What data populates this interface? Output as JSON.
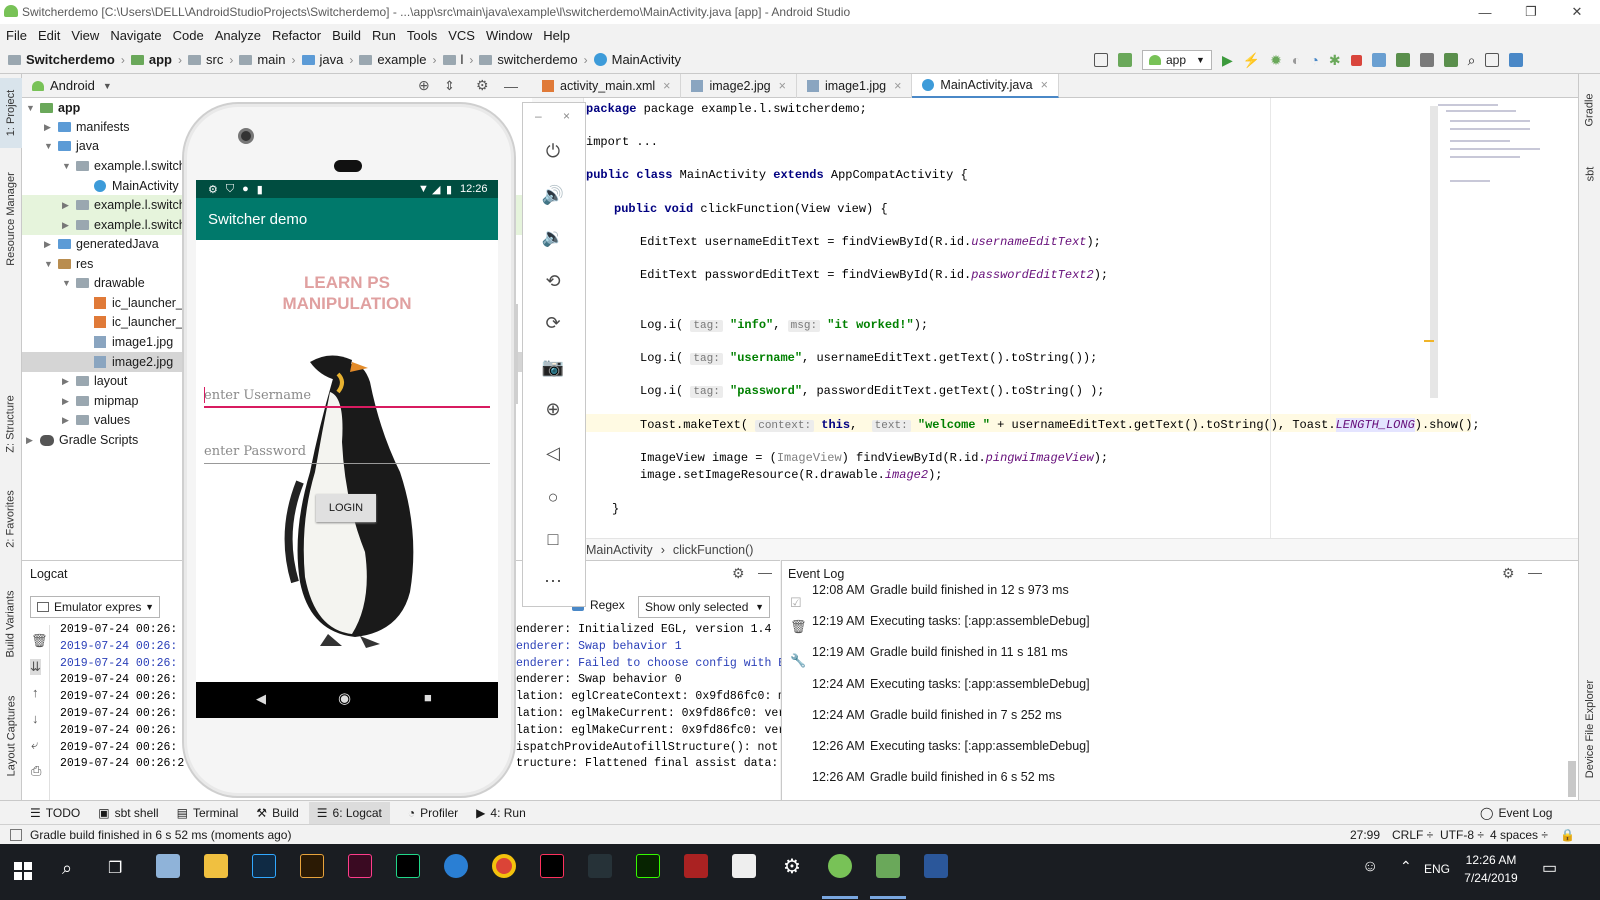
{
  "window": {
    "title": "Switcherdemo [C:\\Users\\DELL\\AndroidStudioProjects\\Switcherdemo] - ...\\app\\src\\main\\java\\example\\l\\switcherdemo\\MainActivity.java [app] - Android Studio",
    "minimize": "—",
    "maximize": "❐",
    "close": "✕"
  },
  "menu": [
    "File",
    "Edit",
    "View",
    "Navigate",
    "Code",
    "Analyze",
    "Refactor",
    "Build",
    "Run",
    "Tools",
    "VCS",
    "Window",
    "Help"
  ],
  "breadcrumb": [
    "Switcherdemo",
    "app",
    "src",
    "main",
    "java",
    "example",
    "l",
    "switcherdemo",
    "MainActivity"
  ],
  "toolbar": {
    "run_config": "app"
  },
  "project": {
    "view": "Android",
    "tree": [
      "app",
      "manifests",
      "java",
      "example.l.switch",
      "MainActivity",
      "example.l.switch",
      "example.l.switch",
      "generatedJava",
      "res",
      "drawable",
      "ic_launcher_b",
      "ic_launcher_f",
      "image1.jpg",
      "image2.jpg",
      "layout",
      "mipmap",
      "values",
      "Gradle Scripts"
    ]
  },
  "left_tabs": [
    "1: Project",
    "Resource Manager",
    "Z: Structure",
    "2: Favorites",
    "Build Variants",
    "Layout Captures"
  ],
  "right_tabs": [
    "Gradle",
    "sbt",
    "Device File Explorer"
  ],
  "editor_tabs": [
    "activity_main.xml",
    "image2.jpg",
    "image1.jpg",
    "MainActivity.java"
  ],
  "code": {
    "l1": "package example.l.switcherdemo;",
    "l2": "import ...",
    "l3a": "public class",
    "l3b": " MainActivity ",
    "l3c": "extends",
    "l3d": " AppCompatActivity {",
    "l4a": "public void",
    "l4b": " clickFunction(View view) {",
    "l5a": "EditText usernameEditText = findViewById(R.id.",
    "l5b": "usernameEditText",
    "l5c": ");",
    "l6a": "EditText passwordEditText = findViewById(R.id.",
    "l6b": "passwordEditText2",
    "l6c": ");",
    "l7a": "Log.i(",
    "l7h1": "tag:",
    "l7s1": "\"info\"",
    "l7b": ", ",
    "l7h2": "msg:",
    "l7s2": "\"it worked!\"",
    "l7c": ");",
    "l8a": "Log.i(",
    "l8h": "tag:",
    "l8s": "\"username\"",
    "l8b": ", usernameEditText.getText().toString());",
    "l9a": "Log.i(",
    "l9h": "tag:",
    "l9s": "\"password\"",
    "l9b": ", passwordEditText.getText().toString() );",
    "l10a": "Toast.makeText(",
    "l10h1": "context:",
    "l10k": "this",
    "l10b": ",  ",
    "l10h2": "text:",
    "l10s": "\"welcome \"",
    "l10c": " + usernameEditText.getText().toString(), Toast.",
    "l10f": "LENGTH_LONG",
    "l10d": ").show();",
    "l11a": "ImageView image = (",
    "l11g": "ImageView",
    "l11b": ") findViewById(R.id.",
    "l11f": "pingwiImageView",
    "l11c": ");",
    "l12a": "image.setImageResource(R.drawable.",
    "l12f": "image2",
    "l12c": ");",
    "l13": "}"
  },
  "editor_crumbs": [
    "MainActivity",
    "clickFunction()"
  ],
  "logcat": {
    "title": "Logcat",
    "device": "Emulator expres",
    "regex": "Regex",
    "filter": "Show only selected",
    "timestamps": [
      "2019-07-24 00:26:",
      "2019-07-24 00:26:",
      "2019-07-24 00:26:",
      "2019-07-24 00:26:",
      "2019-07-24 00:26:",
      "2019-07-24 00:26:",
      "2019-07-24 00:26:",
      "2019-07-24 00:26:",
      "2019-07-24 00:26:2"
    ],
    "messages": [
      "enderer: Initialized EGL, version 1.4",
      "enderer: Swap behavior 1",
      "enderer: Failed to choose config with E",
      "enderer: Swap behavior 0",
      "lation: eglCreateContext: 0x9fd86fc0: m",
      "lation: eglMakeCurrent: 0x9fd86fc0: ver",
      "lation: eglMakeCurrent: 0x9fd86fc0: ver",
      "ispatchProvideAutofillStructure(): not",
      "tructure: Flattened final assist data:"
    ]
  },
  "eventlog": {
    "title": "Event Log",
    "entries": [
      {
        "time": "12:08 AM",
        "text": "Gradle build finished in 12 s 973 ms"
      },
      {
        "time": "12:19 AM",
        "text": "Executing tasks: [:app:assembleDebug]"
      },
      {
        "time": "12:19 AM",
        "text": "Gradle build finished in 11 s 181 ms"
      },
      {
        "time": "12:24 AM",
        "text": "Executing tasks: [:app:assembleDebug]"
      },
      {
        "time": "12:24 AM",
        "text": "Gradle build finished in 7 s 252 ms"
      },
      {
        "time": "12:26 AM",
        "text": "Executing tasks: [:app:assembleDebug]"
      },
      {
        "time": "12:26 AM",
        "text": "Gradle build finished in 6 s 52 ms"
      }
    ]
  },
  "bottom_tabs": [
    "TODO",
    "sbt shell",
    "Terminal",
    "Build",
    "6: Logcat",
    "Profiler",
    "4: Run"
  ],
  "event_log_tab": "Event Log",
  "status": {
    "message": "Gradle build finished in 6 s 52 ms (moments ago)",
    "position": "27:99",
    "line_sep": "CRLF ÷",
    "encoding": "UTF-8 ÷",
    "indent": "4 spaces ÷"
  },
  "phone": {
    "time": "12:26",
    "app_title": "Switcher demo",
    "heading": "LEARN PS\nMANIPULATION",
    "username_hint": "enter Username",
    "password_hint": "enter Password",
    "login": "LOGIN"
  },
  "taskbar": {
    "time": "12:26 AM",
    "date": "7/24/2019",
    "lang": "ENG"
  },
  "colors": {
    "accent": "#4a88c7",
    "app_bar": "#00796b",
    "status_bar": "#004d40",
    "heading": "#e0a0a0",
    "underline": "#d81b60"
  }
}
